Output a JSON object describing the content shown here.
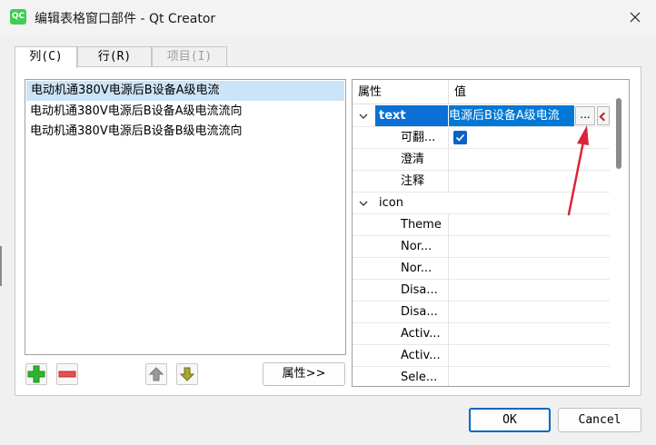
{
  "window": {
    "app_icon_text": "QC",
    "title": "编辑表格窗口部件 - Qt Creator"
  },
  "tabs": [
    {
      "label": "列(C)",
      "state": "active"
    },
    {
      "label": "行(R)",
      "state": "normal"
    },
    {
      "label": "项目(I)",
      "state": "disabled"
    }
  ],
  "list": {
    "items": [
      "电动机通380V电源后B设备A级电流",
      "电动机通380V电源后B设备A级电流流向",
      "电动机通380V电源后B设备B级电流流向"
    ],
    "selected_index": 0
  },
  "toolbar": {
    "add_icon": "plus-icon",
    "remove_icon": "minus-icon",
    "up_icon": "arrow-up-icon",
    "down_icon": "arrow-down-icon",
    "properties_label": "属性>>"
  },
  "property_editor": {
    "header_property": "属性",
    "header_value": "值",
    "rows": [
      {
        "name": "text",
        "value": "电源后B设备A级电流",
        "kind": "group"
      },
      {
        "name": "可翻...",
        "checked": true,
        "kind": "child"
      },
      {
        "name": "澄清",
        "value": "",
        "kind": "child"
      },
      {
        "name": "注释",
        "value": "",
        "kind": "child"
      },
      {
        "name": "icon",
        "kind": "group"
      },
      {
        "name": "Theme",
        "kind": "child"
      },
      {
        "name": "Nor...",
        "kind": "child"
      },
      {
        "name": "Nor...",
        "kind": "child"
      },
      {
        "name": "Disa...",
        "kind": "child"
      },
      {
        "name": "Disa...",
        "kind": "child"
      },
      {
        "name": "Activ...",
        "kind": "child"
      },
      {
        "name": "Activ...",
        "kind": "child"
      },
      {
        "name": "Sele...",
        "kind": "child"
      }
    ],
    "dots_label": "...",
    "accent_color": "#0078d7"
  },
  "dialog_buttons": {
    "ok": "OK",
    "cancel": "Cancel"
  },
  "annotation_arrow_color": "#d9263a"
}
